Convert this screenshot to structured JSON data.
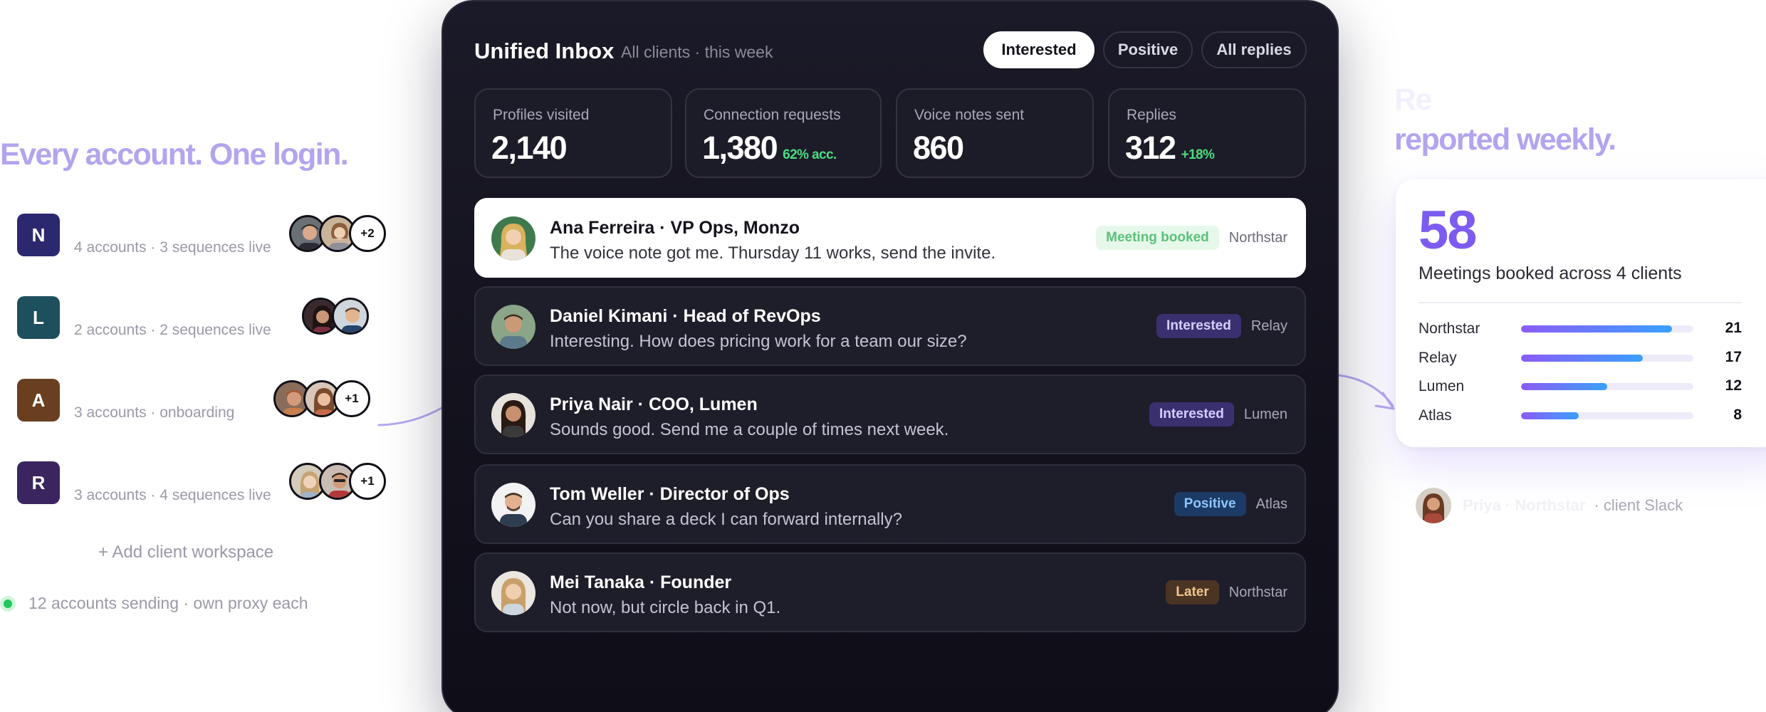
{
  "left": {
    "headline": "Every account. One login.",
    "clients": [
      {
        "letter": "N",
        "color": "#2c2870",
        "meta": "4 accounts · 3 sequences live",
        "more": "+2"
      },
      {
        "letter": "L",
        "color": "#1e4f5c",
        "meta": "2 accounts · 2 sequences live",
        "more": ""
      },
      {
        "letter": "A",
        "color": "#6a3f1f",
        "meta": "3 accounts · onboarding",
        "more": "+1"
      },
      {
        "letter": "R",
        "color": "#3a2560",
        "meta": "3 accounts · 4 sequences live",
        "more": "+1"
      }
    ],
    "add_workspace": "+ Add client workspace",
    "status": "12 accounts sending · own proxy each"
  },
  "inbox": {
    "title": "Unified Inbox",
    "subtitle": "All clients · this week",
    "filters": [
      "Interested",
      "Positive",
      "All replies"
    ],
    "active_filter": "Interested",
    "stats": [
      {
        "label": "Profiles visited",
        "value": "2,140",
        "delta": ""
      },
      {
        "label": "Connection requests",
        "value": "1,380",
        "delta": "62% acc."
      },
      {
        "label": "Voice notes sent",
        "value": "860",
        "delta": ""
      },
      {
        "label": "Replies",
        "value": "312",
        "delta": "+18%"
      }
    ],
    "messages": [
      {
        "name": "Ana Ferreira · VP Ops, Monzo",
        "text": "The voice note got me. Thursday 11 works, send the invite.",
        "tag": "Meeting booked",
        "client": "Northstar"
      },
      {
        "name": "Daniel Kimani · Head of RevOps",
        "text": "Interesting. How does pricing work for a team our size?",
        "tag": "Interested",
        "client": "Relay"
      },
      {
        "name": "Priya Nair · COO, Lumen",
        "text": "Sounds good. Send me a couple of times next week.",
        "tag": "Interested",
        "client": "Lumen"
      },
      {
        "name": "Tom Weller · Director of Ops",
        "text": "Can you share a deck I can forward internally?",
        "tag": "Positive",
        "client": "Atlas"
      },
      {
        "name": "Mei Tanaka · Founder",
        "text": "Not now, but circle back in Q1.",
        "tag": "Later",
        "client": "Northstar"
      }
    ]
  },
  "right": {
    "headline_faded": "Re",
    "headline_line2": "reported weekly.",
    "meetings": {
      "count": "58",
      "caption": "Meetings booked across 4 clients",
      "clients": [
        {
          "name": "Northstar",
          "value": 21,
          "display": "21"
        },
        {
          "name": "Relay",
          "value": 17,
          "display": "17"
        },
        {
          "name": "Lumen",
          "value": 12,
          "display": "12"
        },
        {
          "name": "Atlas",
          "value": 8,
          "display": "8"
        }
      ],
      "scale_max": 24
    },
    "slack": {
      "name": "Priya · Northstar",
      "source": "· client Slack"
    }
  },
  "colors": {
    "accent": "#7c5cf0",
    "headline": "#b4a4ee",
    "panel": "#15141f",
    "success": "#4ade80"
  }
}
